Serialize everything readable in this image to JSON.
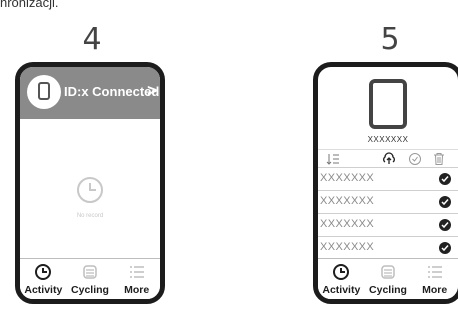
{
  "caption": "nronizacji.",
  "steps": {
    "left_number": "4",
    "right_number": "5"
  },
  "screen4": {
    "header_text": "ID:x Connected",
    "header_chevron": ">",
    "empty_text": "No record",
    "colors": {
      "header_bg": "#8a8a8a"
    }
  },
  "screen5": {
    "device_name": "XXXXXXX",
    "items": [
      {
        "label": "XXXXXXX",
        "checked": true
      },
      {
        "label": "XXXXXXX",
        "checked": true
      },
      {
        "label": "XXXXXXX",
        "checked": true
      },
      {
        "label": "XXXXXXX",
        "checked": true
      }
    ],
    "toolbar_icons": [
      "sort-icon",
      "upload-cloud-icon",
      "check-circle-icon",
      "trash-icon"
    ]
  },
  "tabs": [
    {
      "label": "Activity",
      "icon": "clock-icon",
      "active": true
    },
    {
      "label": "Cycling",
      "icon": "cycling-icon",
      "active": false
    },
    {
      "label": "More",
      "icon": "list-icon",
      "active": false
    }
  ]
}
